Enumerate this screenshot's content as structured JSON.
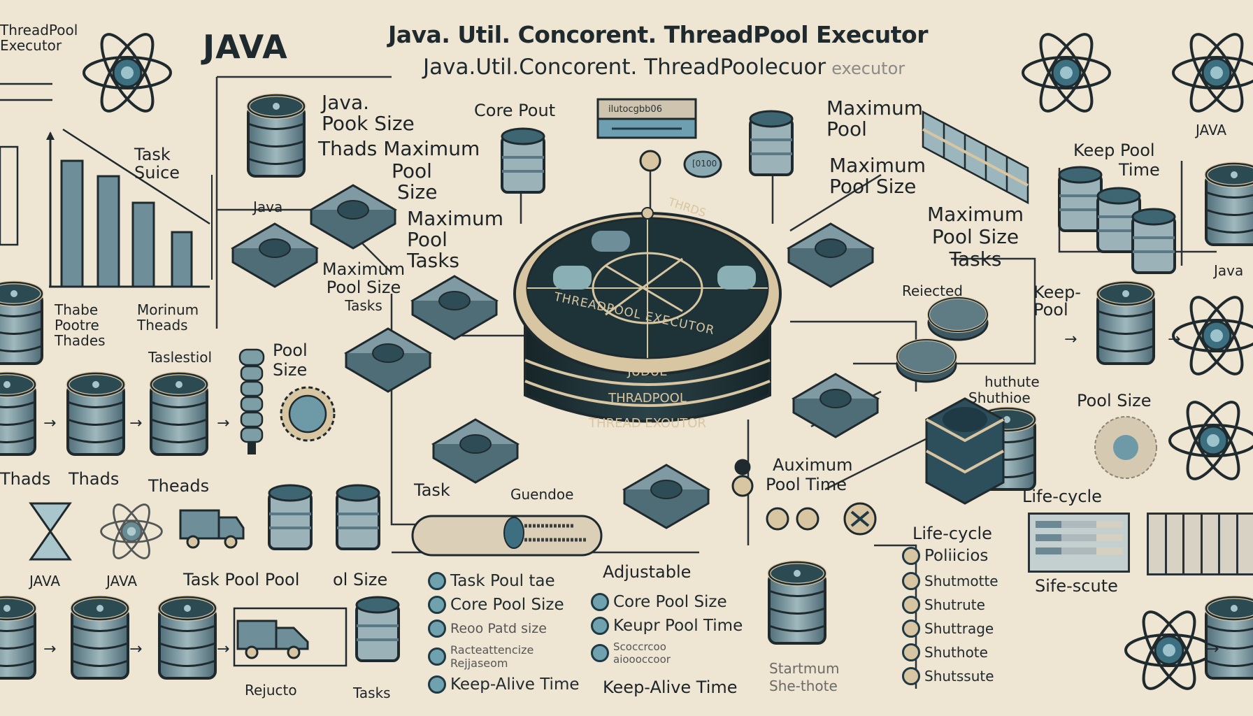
{
  "header": {
    "java_logo": "JAVA",
    "title_line1": "Java. Util. Concorent. ThreadPool Executor",
    "title_line2": "Java.Util.Concorent. ThreadPoolecuor",
    "title_line2_faint": "executor",
    "corner_label_top_left": "ThreadPool Executor"
  },
  "center_hub": {
    "top_text": "THRDS",
    "ring_text": "THREADPOOL EXECUTOR",
    "band_1": "JUDUE",
    "band_2": "THRADPOOL",
    "band_3": "THREAD EXOUTOR"
  },
  "top_left_chart": {
    "label": "Task Suice",
    "x_label_1": "Thabe Pootre Thades",
    "x_label_2": "Morinum Theads",
    "x_label_3": "Taslestiol"
  },
  "labels": {
    "java_pool_block": [
      "Java.",
      "Pook Size",
      "Thads Maximum",
      "Pool",
      "Size"
    ],
    "java_under_barrel": "Java",
    "max_pool_tasks_1": [
      "Maximum",
      "Pool",
      "Tasks"
    ],
    "max_pool_size_tasks_left": [
      "Maximum",
      "Pool Size",
      "Tasks"
    ],
    "core_pool": "Core Pout",
    "max_pool_top": [
      "Maximum",
      "Pool"
    ],
    "max_pool_size_top": [
      "Maximum",
      "Pool Size"
    ],
    "max_pool_size_tasks_right": [
      "Maximum",
      "Pool Size",
      "Tasks"
    ],
    "keep_pool_time": [
      "Keep Pool",
      "Time"
    ],
    "java_right_top": "JAVA",
    "java_right_barrel": "Java",
    "rejected": "Reiected",
    "keep_pool": [
      "Keep-",
      "Pool"
    ],
    "shutdown_pair": [
      "huthute",
      "Shuthioe"
    ],
    "pool_size_right": "Pool Size",
    "pool_size_spindle": [
      "Pool",
      "Size"
    ],
    "auxmum_pool_time": [
      "Auximum",
      "Pool Time"
    ],
    "task": "Task",
    "queued": "Guendoe",
    "threads_row": [
      "Thads",
      "Thads",
      "Theads"
    ],
    "java_hourglass": "JAVA",
    "java_atom": "JAVA",
    "task_pool_pool": "Task Pool Pool",
    "pool_size_bottom": "ol Size",
    "reject_bottom": "Rejucto",
    "tasks_bottom": "Tasks",
    "adjustable": "Adjustable",
    "lifecycle_mid": "Life-cycle",
    "lifecycle_right": "Life-cycle",
    "life_state": "Sife-scute",
    "startmum_shutdown": [
      "Startmum",
      "She-thote"
    ],
    "monitor_text": "ilutocgbb06",
    "pill_text": "[0100"
  },
  "lists": {
    "left": [
      "Task Poul tae",
      "Core Pool Size",
      "Reoo Patd size",
      "Racteattencize Rejjaseom",
      "Keep-Alive Time"
    ],
    "middle": [
      "Core Pool Size",
      "Keupr Pool Time",
      "Scoccrcoo aioooccoor"
    ],
    "middle_footer": "Keep-Alive Time",
    "lifecycle": [
      "Poliicios",
      "Shutmotte",
      "Shutrute",
      "Shuttrage",
      "Shuthote",
      "Shutssute"
    ]
  },
  "colors": {
    "background": "#efe5d3",
    "ink": "#1c2428",
    "hub_dark": "#1e3237",
    "steel_blue": "#6e99a6",
    "slate": "#8fa7ae",
    "sand": "#d8c6a2"
  }
}
